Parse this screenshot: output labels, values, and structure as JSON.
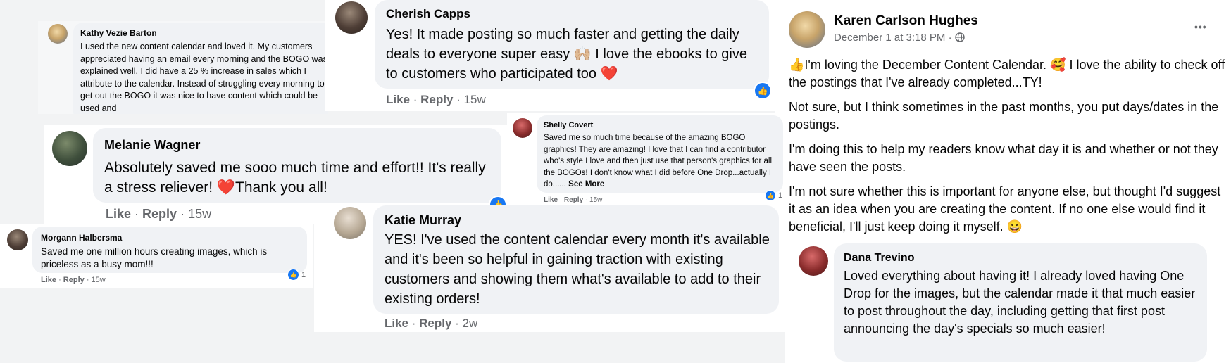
{
  "comments": {
    "kathy": {
      "name": "Kathy Vezie Barton",
      "text": "I used the new content calendar and loved it. My customers appreciated having an email every morning and the BOGO was explained well. I did have a 25 % increase in sales which I attribute to the calendar. Instead of struggling every morning to get out the BOGO it was nice to have content which could be used and"
    },
    "cherish": {
      "name": "Cherish Capps",
      "text": "Yes! It made posting so much faster and getting the daily deals to everyone super easy 🙌🏼 I love the ebooks to give to customers who participated too",
      "heart": "❤️",
      "like": "Like",
      "reply": "Reply",
      "time": "15w"
    },
    "karen": {
      "name": "Karen Carlson Hughes",
      "date": "December 1 at 3:18 PM · ",
      "globe_icon": "globe-icon",
      "more_icon": "more-options-icon",
      "more_glyph": "•••",
      "p1": "👍I'm loving the December Content Calendar. 🥰 I love the ability to check off the postings that I've already completed...TY!",
      "p2": "Not sure, but I think sometimes in the past months, you put days/dates in the postings.",
      "p3": " I'm doing this to help my readers know what day it is and whether or not they have seen the posts.",
      "p4": "I'm not sure whether this is important for anyone else, but thought I'd suggest it as an idea when you are creating the content.  If no one else would find it beneficial, I'll just keep doing it myself.  😀"
    },
    "melanie": {
      "name": "Melanie Wagner",
      "text": "Absolutely saved me sooo much time and effort!! It's really a stress reliever! ",
      "heart": "❤️",
      "text2": "Thank you all!",
      "like": "Like",
      "reply": "Reply",
      "time": "15w"
    },
    "shelly": {
      "name": "Shelly Covert",
      "text": "Saved me so much time because of the amazing BOGO graphics! They are amazing! I love that I can find a contributor who's style I love and then just use that person's graphics for all the BOGOs! I don't know what I did before One Drop...actually I do...... ",
      "see_more": "See More",
      "like": "Like",
      "reply": "Reply",
      "time": "15w",
      "reactions": "1"
    },
    "morgann": {
      "name": "Morgann Halbersma",
      "text": "Saved me one million hours creating images, which is priceless as a busy mom!!!",
      "like": "Like",
      "reply": "Reply",
      "time": "15w",
      "reactions": "1"
    },
    "katie": {
      "name": "Katie Murray",
      "text": "YES! I've used the content calendar every month it's available and it's been so helpful in gaining traction with existing customers and showing them what's available to add to their existing orders!",
      "like": "Like",
      "reply": "Reply",
      "time": "2w"
    },
    "dana": {
      "name": "Dana Trevino",
      "text": "Loved everything about having it! I already loved having One Drop for the images, but the calendar made it that much easier to post throughout the day, including getting that first post announcing the day's specials so much easier!"
    }
  },
  "ui": {
    "separator": " · ",
    "like_badge_glyph": "👍",
    "colors": {
      "like_blue": "#1877f2",
      "bubble_bg": "#f0f2f5",
      "meta_grey": "#65676b",
      "heart_red": "#e41e3f"
    }
  }
}
